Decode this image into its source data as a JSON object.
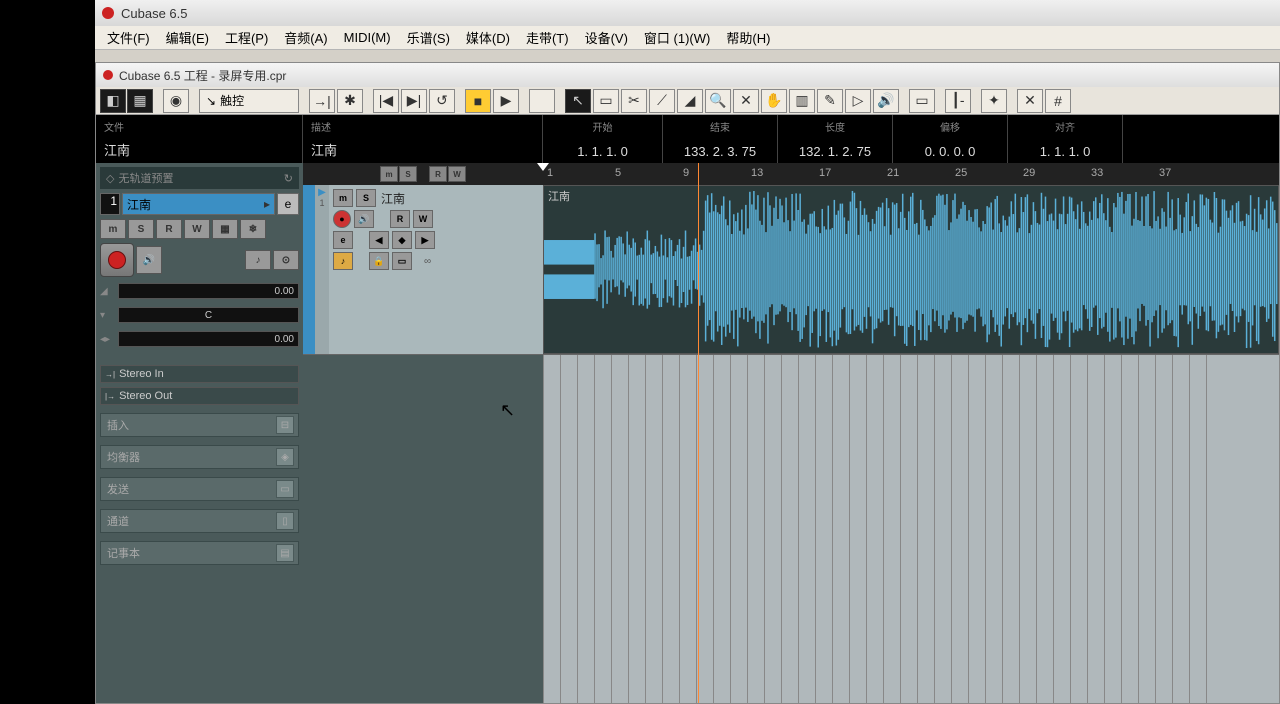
{
  "app": {
    "title": "Cubase 6.5"
  },
  "menu": {
    "file": "文件(F)",
    "edit": "编辑(E)",
    "project": "工程(P)",
    "audio": "音频(A)",
    "midi": "MIDI(M)",
    "score": "乐谱(S)",
    "media": "媒体(D)",
    "transport": "走带(T)",
    "device": "设备(V)",
    "window": "窗口 (1)(W)",
    "help": "帮助(H)"
  },
  "subwindow": {
    "title": "Cubase 6.5 工程 - 录屏专用.cpr"
  },
  "toolbar": {
    "automation_mode": "触控"
  },
  "info": {
    "file_label": "文件",
    "file_value": "江南",
    "desc_label": "描述",
    "desc_value": "江南",
    "start_label": "开始",
    "start_value": "1. 1. 1.   0",
    "end_label": "结束",
    "end_value": "133. 2. 3. 75",
    "length_label": "长度",
    "length_value": "132. 1. 2. 75",
    "offset_label": "偏移",
    "offset_value": "0. 0. 0.   0",
    "snap_label": "对齐",
    "snap_value": "1. 1. 1.   0"
  },
  "inspector": {
    "preset": "无轨道预置",
    "track_num": "1",
    "track_name": "江南",
    "btns": {
      "m": "m",
      "s": "S",
      "r": "R",
      "w": "W"
    },
    "volume": "0.00",
    "pan_c": "C",
    "delay": "0.00",
    "stereo_in": "Stereo In",
    "stereo_out": "Stereo Out",
    "sections": {
      "insert": "插入",
      "eq": "均衡器",
      "send": "发送",
      "channel": "通道",
      "notepad": "记事本"
    }
  },
  "track_header": {
    "m": "m",
    "s": "S",
    "r": "R",
    "w": "W"
  },
  "track": {
    "num": "1",
    "name": "江南",
    "m": "m",
    "s": "S",
    "r": "R",
    "w": "W",
    "e": "e"
  },
  "ruler": {
    "marks": [
      "1",
      "5",
      "9",
      "13",
      "17",
      "21",
      "25",
      "29",
      "33",
      "37"
    ]
  },
  "clip": {
    "name": "江南"
  }
}
